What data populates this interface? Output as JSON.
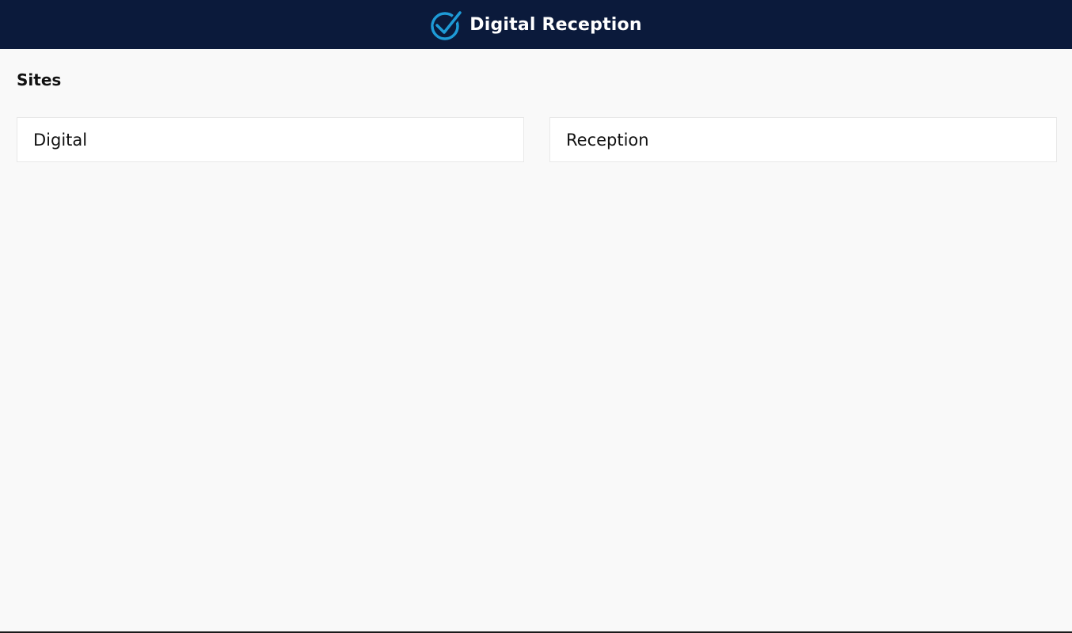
{
  "header": {
    "title": "Digital Reception",
    "logo_icon": "check-circle-icon",
    "background_color": "#0b1a3b",
    "logo_color": "#1e9bd7"
  },
  "sites": {
    "heading": "Sites",
    "items": [
      {
        "label": "Digital"
      },
      {
        "label": "Reception"
      }
    ]
  }
}
